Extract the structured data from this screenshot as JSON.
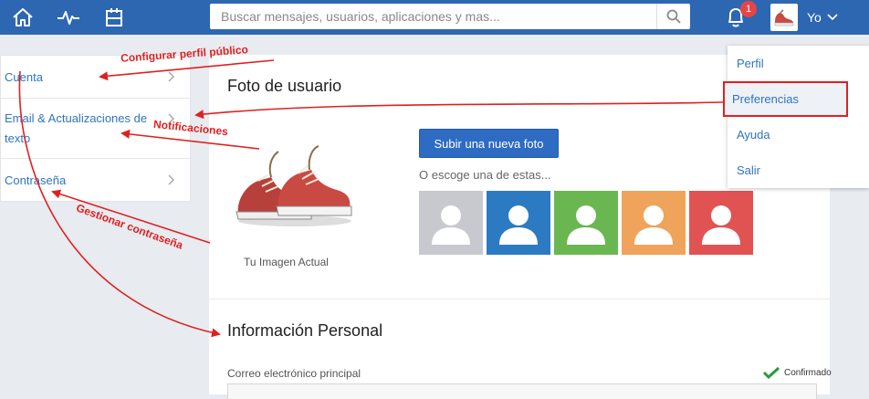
{
  "topbar": {
    "search_placeholder": "Buscar mensajes, usuarios, aplicaciones y mas...",
    "notifications_count": "1",
    "user_label": "Yo"
  },
  "left_menu": {
    "items": [
      {
        "label": "Cuenta"
      },
      {
        "label": "Email & Actualizaciones de texto"
      },
      {
        "label": "Contraseña"
      }
    ]
  },
  "photo_section": {
    "title": "Foto de usuario",
    "current_label": "Tu Imagen Actual",
    "upload_button": "Subir una nueva foto",
    "choose_label": "O escoge una de estas...",
    "avatar_colors": [
      "#c7c9ce",
      "#2c7bc2",
      "#6ab752",
      "#f0a35a",
      "#e05352"
    ]
  },
  "personal_section": {
    "title": "Información Personal",
    "email_label": "Correo electrónico principal",
    "confirmed": "Confirmado"
  },
  "user_dropdown": {
    "items": [
      {
        "label": "Perfil"
      },
      {
        "label": "Preferencias"
      },
      {
        "label": "Ayuda"
      },
      {
        "label": "Salir"
      }
    ]
  },
  "annotations": {
    "cuenta": "Configurar perfil público",
    "email": "Notificaciones",
    "password": "Gestionar contraseña"
  },
  "colors": {
    "topbar": "#2d67b2",
    "link": "#2e75c0",
    "annotation": "#e02020",
    "badge": "#e64545"
  }
}
